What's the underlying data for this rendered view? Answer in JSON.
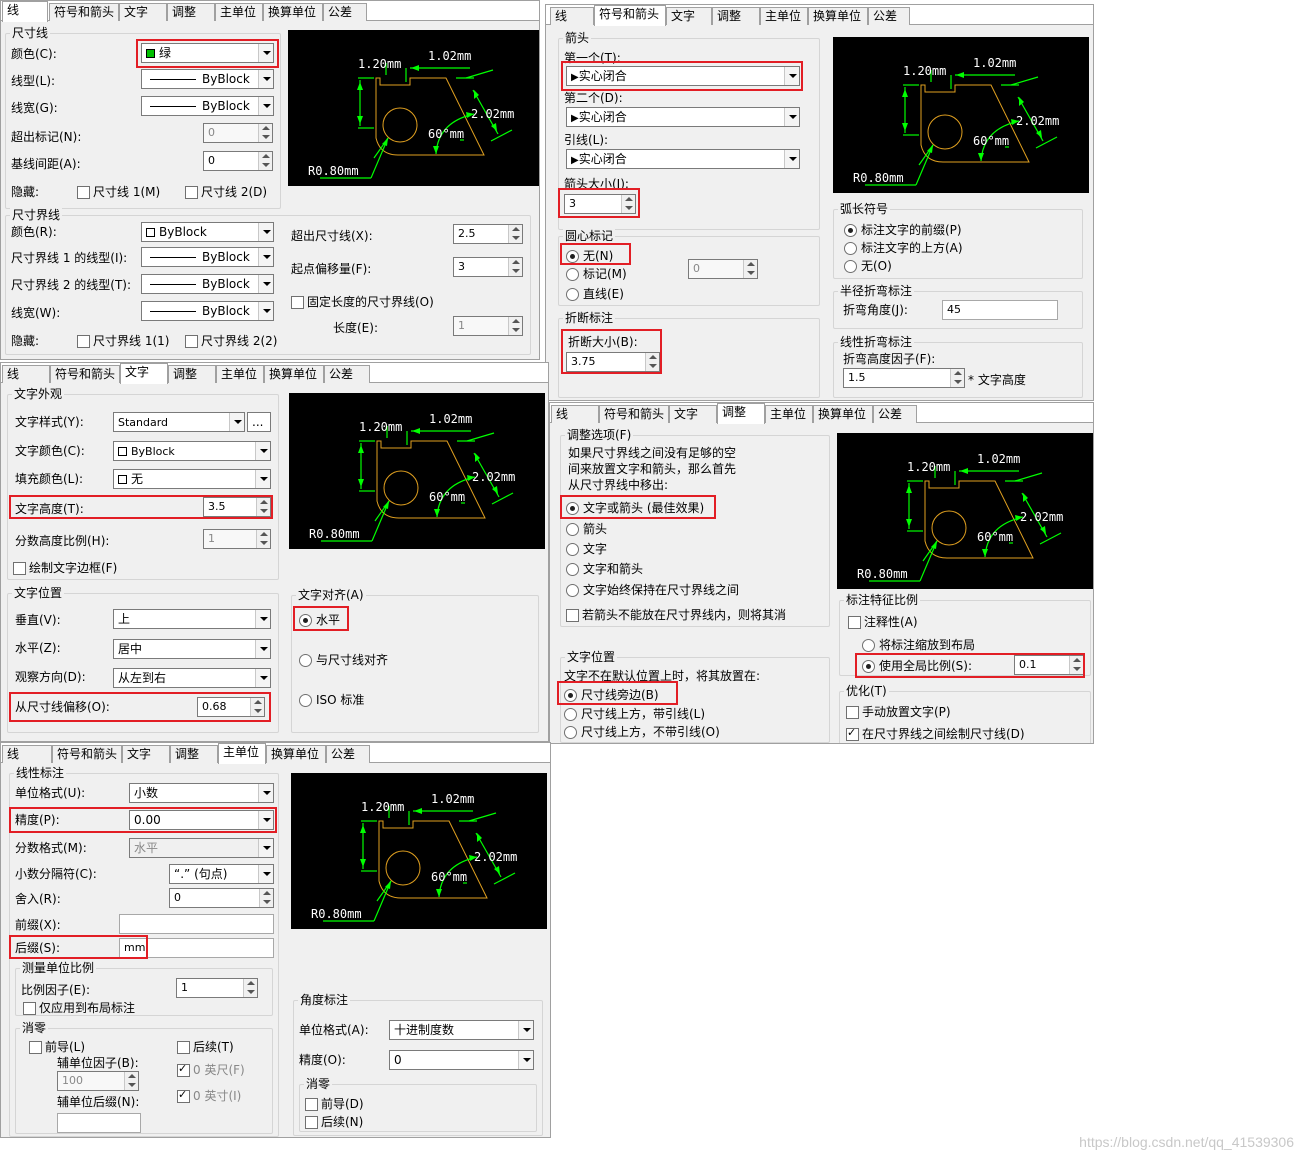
{
  "tabs": [
    "线",
    "符号和箭头",
    "文字",
    "调整",
    "主单位",
    "换算单位",
    "公差"
  ],
  "preview": {
    "d1": "1.20mm",
    "d2": "1.02mm",
    "d3": "2.02mm",
    "d4": "60°mm",
    "d5": "R0.80mm"
  },
  "colors": {
    "highlight": "#e21e25",
    "green": "#00ff00",
    "preview_bg": "#000000",
    "shape": "#ffa500"
  },
  "p1": {
    "g_dimline": "尺寸线",
    "color_label": "颜色(C):",
    "color_value": "绿",
    "ltype_label": "线型(L):",
    "ltype_value": "ByBlock",
    "lweight_label": "线宽(G):",
    "lweight_value": "ByBlock",
    "ext_label": "超出标记(N):",
    "ext_value": "0",
    "base_label": "基线间距(A):",
    "base_value": "0",
    "hide_label": "隐藏:",
    "hide1": "尺寸线 1(M)",
    "hide2": "尺寸线 2(D)",
    "g_extline": "尺寸界线",
    "ecolor_label": "颜色(R):",
    "ecolor_value": "ByBlock",
    "elt1_label": "尺寸界线 1 的线型(I):",
    "elt1_value": "ByBlock",
    "elt2_label": "尺寸界线 2 的线型(T):",
    "elt2_value": "ByBlock",
    "elw_label": "线宽(W):",
    "elw_value": "ByBlock",
    "ehide_label": "隐藏:",
    "ehide1": "尺寸界线 1(1)",
    "ehide2": "尺寸界线 2(2)",
    "beyond_label": "超出尺寸线(X):",
    "beyond_value": "2.5",
    "offset_label": "起点偏移量(F):",
    "offset_value": "3",
    "fixed_label": "固定长度的尺寸界线(O)",
    "length_label": "长度(E):",
    "length_value": "1"
  },
  "p2": {
    "g_arrows": "箭头",
    "first_label": "第一个(T):",
    "first_value": "实心闭合",
    "second_label": "第二个(D):",
    "second_value": "实心闭合",
    "leader_label": "引线(L):",
    "leader_value": "实心闭合",
    "size_label": "箭头大小(I):",
    "size_value": "3",
    "g_center": "圆心标记",
    "c_none": "无(N)",
    "c_mark": "标记(M)",
    "c_line": "直线(E)",
    "c_value": "0",
    "g_break": "折断标注",
    "break_label": "折断大小(B):",
    "break_value": "3.75",
    "g_arc": "弧长符号",
    "arc1": "标注文字的前缀(P)",
    "arc2": "标注文字的上方(A)",
    "arc3": "无(O)",
    "g_radius": "半径折弯标注",
    "jog_label": "折弯角度(J):",
    "jog_value": "45",
    "g_linjog": "线性折弯标注",
    "jogh_label": "折弯高度因子(F):",
    "jogh_value": "1.5",
    "jogh_unit": "* 文字高度"
  },
  "p3": {
    "g_appear": "文字外观",
    "style_label": "文字样式(Y):",
    "style_value": "Standard",
    "style_btn": "...",
    "tcolor_label": "文字颜色(C):",
    "tcolor_value": "ByBlock",
    "fill_label": "填充颜色(L):",
    "fill_value": "无",
    "height_label": "文字高度(T):",
    "height_value": "3.5",
    "frac_label": "分数高度比例(H):",
    "frac_value": "1",
    "frame_label": "绘制文字边框(F)",
    "g_pos": "文字位置",
    "vert_label": "垂直(V):",
    "vert_value": "上",
    "horz_label": "水平(Z):",
    "horz_value": "居中",
    "view_label": "观察方向(D):",
    "view_value": "从左到右",
    "offset_label": "从尺寸线偏移(O):",
    "offset_value": "0.68",
    "g_align": "文字对齐(A)",
    "a1": "水平",
    "a2": "与尺寸线对齐",
    "a3": "ISO 标准"
  },
  "p4": {
    "g_fit": "调整选项(F)",
    "fit_desc1": "如果尺寸界线之间没有足够的空",
    "fit_desc2": "间来放置文字和箭头，那么首先",
    "fit_desc3": "从尺寸界线中移出:",
    "f1": "文字或箭头 (最佳效果)",
    "f2": "箭头",
    "f3": "文字",
    "f4": "文字和箭头",
    "f5": "文字始终保持在尺寸界线之间",
    "suppress": "若箭头不能放在尺寸界线内，则将其消",
    "g_tpos": "文字位置",
    "tpos_desc": "文字不在默认位置上时，将其放置在:",
    "t1": "尺寸线旁边(B)",
    "t2": "尺寸线上方，带引线(L)",
    "t3": "尺寸线上方，不带引线(O)",
    "g_scale": "标注特征比例",
    "annot": "注释性(A)",
    "layout": "将标注缩放到布局",
    "overall": "使用全局比例(S):",
    "overall_value": "0.1",
    "g_fine": "优化(T)",
    "manual": "手动放置文字(P)",
    "drawbetween": "在尺寸界线之间绘制尺寸线(D)"
  },
  "p5": {
    "g_linear": "线性标注",
    "unit_label": "单位格式(U):",
    "unit_value": "小数",
    "prec_label": "精度(P):",
    "prec_value": "0.00",
    "frac_label": "分数格式(M):",
    "frac_value": "水平",
    "sep_label": "小数分隔符(C):",
    "sep_value": "“.” (句点)",
    "round_label": "舍入(R):",
    "round_value": "0",
    "prefix_label": "前缀(X):",
    "suffix_label": "后缀(S):",
    "suffix_value": "mm",
    "g_scale": "测量单位比例",
    "sf_label": "比例因子(E):",
    "sf_value": "1",
    "layout_only": "仅应用到布局标注",
    "g_zero": "消零",
    "leading": "前导(L)",
    "trailing": "后续(T)",
    "subfactor_label": "辅单位因子(B):",
    "subfactor_value": "100",
    "feet": "0 英尺(F)",
    "inches": "0 英寸(I)",
    "subsuffix_label": "辅单位后缀(N):",
    "g_angle": "角度标注",
    "aunit_label": "单位格式(A):",
    "aunit_value": "十进制度数",
    "aprec_label": "精度(O):",
    "aprec_value": "0",
    "g_azero": "消零",
    "aleading": "前导(D)",
    "atrailing": "后续(N)"
  },
  "watermark": "https://blog.csdn.net/qq_41539306"
}
